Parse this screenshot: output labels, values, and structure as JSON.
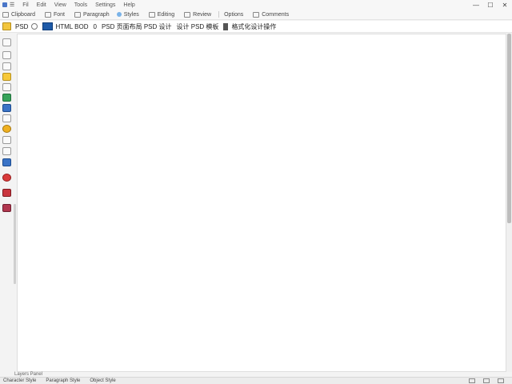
{
  "titlebar": {
    "menu": [
      "☰",
      "Fil",
      "Edit",
      "View",
      "Tools",
      "Settings",
      "Help"
    ],
    "controls": [
      "—",
      "☐",
      "✕"
    ]
  },
  "ribbon": {
    "items": [
      "Clipboard",
      "Font",
      "Paragraph",
      "Styles",
      "Editing",
      "Review",
      "Options",
      "Comments"
    ]
  },
  "addrbar": {
    "label": "PSD",
    "segments": [
      "HTML BOD",
      "0",
      "PSD 页面布局 PSD 设计",
      "设计 PSD 模板",
      "格式化设计操作"
    ]
  },
  "subbar": {
    "text": "Layers Panel"
  },
  "status": {
    "items": [
      "Character Style",
      "Paragraph Style",
      "Object Style"
    ]
  },
  "colors": {
    "accent": "#1e5aa8",
    "folder": "#f2c53d"
  },
  "icons": {
    "app": "app-icon",
    "folder": "folder-icon",
    "monitor": "monitor-icon"
  }
}
